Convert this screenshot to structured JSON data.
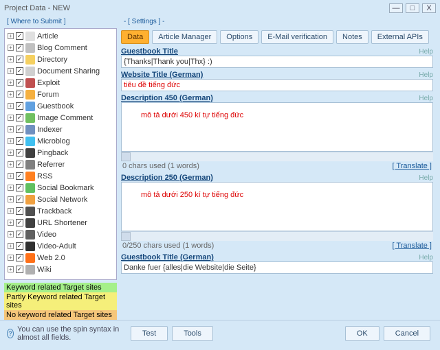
{
  "title": "Project Data - NEW",
  "left_header": "[ Where to Submit ]",
  "settings_label": "- [ Settings ] -",
  "tabs": [
    "Data",
    "Article Manager",
    "Options",
    "E-Mail verification",
    "Notes",
    "External APIs"
  ],
  "tree": [
    {
      "label": "Article",
      "color": "#e0e0e0"
    },
    {
      "label": "Blog Comment",
      "color": "#c0c0c0"
    },
    {
      "label": "Directory",
      "color": "#f5d060"
    },
    {
      "label": "Document Sharing",
      "color": "#d0d0d0"
    },
    {
      "label": "Exploit",
      "color": "#c05050"
    },
    {
      "label": "Forum",
      "color": "#f5b040"
    },
    {
      "label": "Guestbook",
      "color": "#60a0e0"
    },
    {
      "label": "Image Comment",
      "color": "#70c060"
    },
    {
      "label": "Indexer",
      "color": "#7090c0"
    },
    {
      "label": "Microblog",
      "color": "#40c0f0"
    },
    {
      "label": "Pingback",
      "color": "#404040"
    },
    {
      "label": "Referrer",
      "color": "#808080"
    },
    {
      "label": "RSS",
      "color": "#ff8020"
    },
    {
      "label": "Social Bookmark",
      "color": "#60c060"
    },
    {
      "label": "Social Network",
      "color": "#f0a040"
    },
    {
      "label": "Trackback",
      "color": "#505050"
    },
    {
      "label": "URL Shortener",
      "color": "#404040"
    },
    {
      "label": "Video",
      "color": "#606060"
    },
    {
      "label": "Video-Adult",
      "color": "#303030"
    },
    {
      "label": "Web 2.0",
      "color": "#ff7018"
    },
    {
      "label": "Wiki",
      "color": "#b0b0b0"
    }
  ],
  "legend": {
    "g": "Keyword related Target sites",
    "y": "Partly Keyword related Target sites",
    "o": "No keyword related Target sites"
  },
  "fields": {
    "f1": {
      "label": "Guestbook Title",
      "value": "{Thanks|Thank you|Thx} :)"
    },
    "f2": {
      "label": "Website Title (German)",
      "value": "tiêu đề tiếng đức"
    },
    "f3": {
      "label": "Description 450 (German)",
      "value": "mô tả dưới 450 kí tự tiếng đức",
      "meta": "0 chars used (1 words)"
    },
    "f4": {
      "label": "Description 250 (German)",
      "value": "mô tả dưới 250 kí tự tiếng đức",
      "meta": "0/250 chars used (1 words)"
    },
    "f5": {
      "label": "Guestbook Title (German)",
      "value": "Danke fuer {alles|die Website|die Seite}"
    }
  },
  "help": "Help",
  "translate": "[ Translate ]",
  "hint": "You can use the spin syntax in almost all fields.",
  "buttons": {
    "test": "Test",
    "tools": "Tools",
    "ok": "OK",
    "cancel": "Cancel"
  }
}
